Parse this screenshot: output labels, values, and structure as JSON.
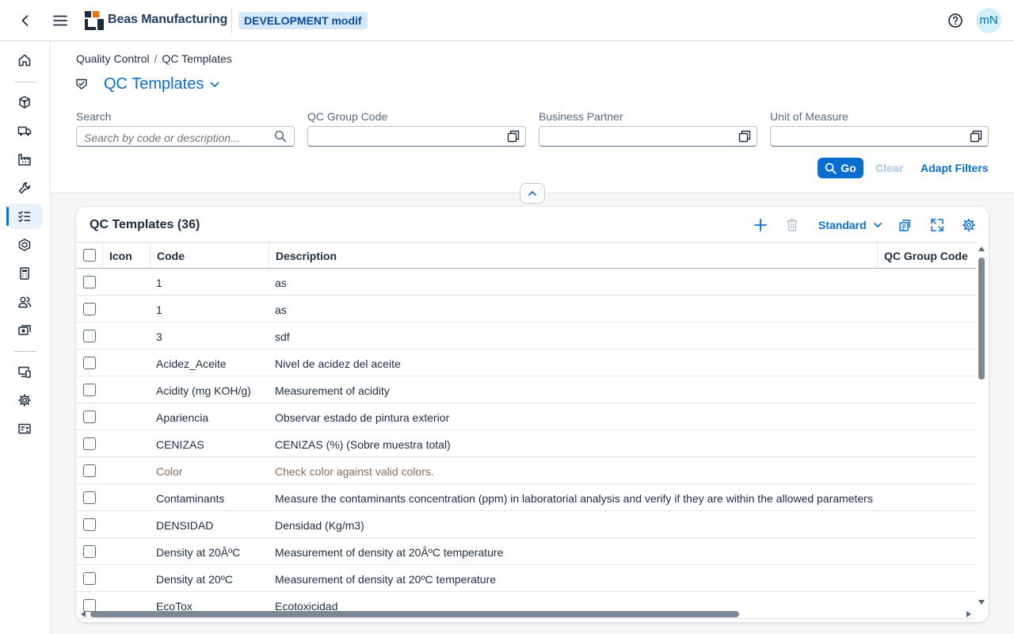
{
  "shell": {
    "brand": "Beas Manufacturing",
    "environment": "DEVELOPMENT modif",
    "avatar_initials": "mN"
  },
  "sidenav": {
    "items": [
      {
        "icon": "home-icon",
        "active": false
      },
      {
        "icon": "cubes-icon",
        "active": false
      },
      {
        "icon": "delivery-truck-icon",
        "active": false
      },
      {
        "icon": "factory-icon",
        "active": false
      },
      {
        "icon": "wrench-icon",
        "active": false
      },
      {
        "icon": "checklist-icon",
        "active": true
      },
      {
        "icon": "package-icon",
        "active": false
      },
      {
        "icon": "calculator-icon",
        "active": false
      },
      {
        "icon": "people-icon",
        "active": false
      },
      {
        "icon": "money-icon",
        "active": false
      },
      {
        "icon": "devices-icon",
        "active": false
      },
      {
        "icon": "gear-icon",
        "active": false
      },
      {
        "icon": "id-card-icon",
        "active": false
      }
    ]
  },
  "breadcrumb": {
    "parent": "Quality Control",
    "current": "QC Templates"
  },
  "page": {
    "title": "QC Templates"
  },
  "filters": {
    "search": {
      "label": "Search",
      "placeholder": "Search by code or description..."
    },
    "qc_group_code": {
      "label": "QC Group Code",
      "value": ""
    },
    "business_partner": {
      "label": "Business Partner",
      "value": ""
    },
    "unit_of_measure": {
      "label": "Unit of Measure",
      "value": ""
    },
    "go_label": "Go",
    "clear_label": "Clear",
    "adapt_label": "Adapt Filters"
  },
  "table": {
    "title": "QC Templates (36)",
    "variant": "Standard",
    "columns": [
      "Icon",
      "Code",
      "Description",
      "QC Group Code"
    ],
    "rows": [
      {
        "code": "1",
        "description": "as",
        "muted": false
      },
      {
        "code": "1",
        "description": "as",
        "muted": false
      },
      {
        "code": "3",
        "description": "sdf",
        "muted": false
      },
      {
        "code": "Acidez_Aceite",
        "description": "Nivel de acidez del aceite",
        "muted": false
      },
      {
        "code": "Acidity (mg KOH/g)",
        "description": "Measurement of acidity",
        "muted": false
      },
      {
        "code": "Apariencia",
        "description": "Observar estado de pintura exterior",
        "muted": false
      },
      {
        "code": "CENIZAS",
        "description": "CENIZAS (%) (Sobre muestra total)",
        "muted": false
      },
      {
        "code": "Color",
        "description": "Check color against valid colors.",
        "muted": true
      },
      {
        "code": "Contaminants",
        "description": "Measure the contaminants concentration (ppm) in laboratorial analysis and verify if they are within the allowed parameters",
        "muted": false
      },
      {
        "code": "DENSIDAD",
        "description": "Densidad (Kg/m3)",
        "muted": false
      },
      {
        "code": "Density at 20ÂºC",
        "description": "Measurement of density at 20ÂºC temperature",
        "muted": false
      },
      {
        "code": "Density at 20ºC",
        "description": "Measurement of density at 20ºC temperature",
        "muted": false
      },
      {
        "code": "EcoTox",
        "description": "Ecotoxicidad",
        "muted": false
      }
    ]
  },
  "colors": {
    "accent": "#0a6ed1",
    "brand": "#1f3d66",
    "muted_row": "#8a6b5b"
  }
}
